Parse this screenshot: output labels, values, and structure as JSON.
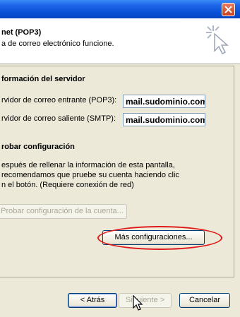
{
  "window": {
    "close_label": "close"
  },
  "header": {
    "title": "net (POP3)",
    "subtitle": "a de correo electrónico funcione."
  },
  "server_info": {
    "section_title": "formación del servidor",
    "incoming_label": "rvidor de correo entrante (POP3):",
    "incoming_value": "mail.sudominio.com",
    "outgoing_label": "rvidor de correo saliente (SMTP):",
    "outgoing_value": "mail.sudominio.com"
  },
  "test": {
    "section_title": "robar configuración",
    "line1": "espués de rellenar la información de esta pantalla,",
    "line2": "recomendamos que pruebe su cuenta haciendo clic",
    "line3": "n el botón. (Requiere conexión de red)",
    "test_button": "Probar configuración de la cuenta..."
  },
  "more_settings_button": "Más configuraciones...",
  "footer": {
    "back_button": "< Atrás",
    "next_button": "Siguiente >",
    "cancel_button": "Cancelar"
  },
  "colors": {
    "titlebar": "#0a50d6",
    "dialog_bg": "#ece9d8",
    "highlight": "#e01818"
  }
}
